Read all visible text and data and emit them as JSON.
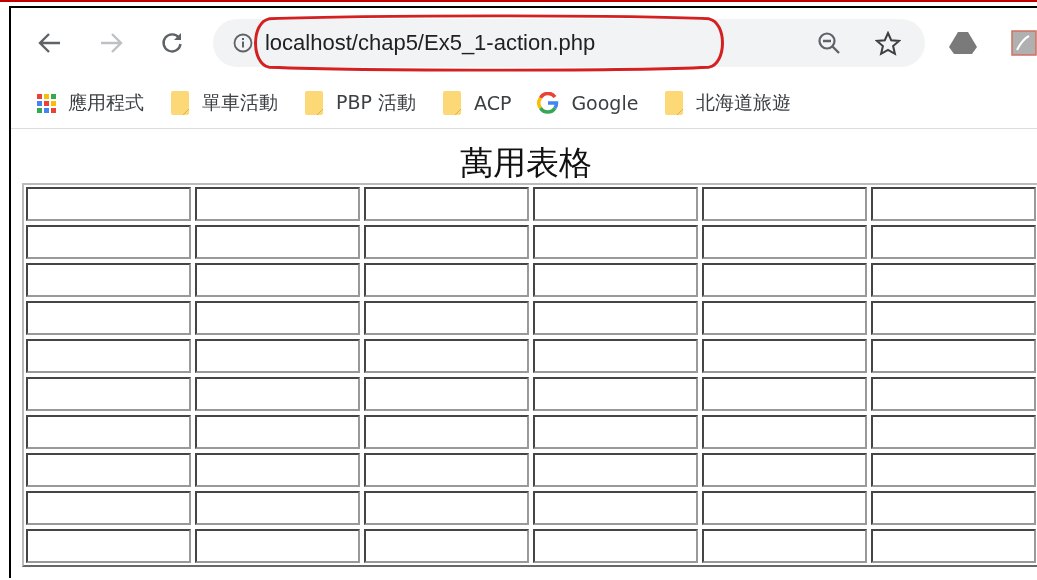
{
  "browser": {
    "url": "localhost/chap5/Ex5_1-action.php"
  },
  "bookmarks": [
    {
      "kind": "apps",
      "label": "應用程式"
    },
    {
      "kind": "folder",
      "label": "單車活動"
    },
    {
      "kind": "folder",
      "label": "PBP 活動"
    },
    {
      "kind": "folder",
      "label": "ACP"
    },
    {
      "kind": "google",
      "label": "Google"
    },
    {
      "kind": "folder",
      "label": "北海道旅遊"
    }
  ],
  "page": {
    "heading": "萬用表格",
    "table": {
      "rows": [
        {
          "cells": [
            {
              "kind": "blank"
            },
            {
              "kind": "blank"
            },
            {
              "kind": "blank"
            },
            {
              "kind": "blank"
            },
            {
              "kind": "blank"
            },
            {
              "kind": "blank"
            }
          ]
        },
        {
          "cells": [
            {
              "kind": "blank"
            },
            {
              "kind": "blank"
            },
            {
              "kind": "blank"
            },
            {
              "kind": "blank"
            },
            {
              "kind": "blank"
            },
            {
              "kind": "blank"
            }
          ]
        },
        {
          "cells": [
            {
              "kind": "blank"
            },
            {
              "kind": "blank"
            },
            {
              "kind": "blank"
            },
            {
              "kind": "blank"
            },
            {
              "kind": "blank"
            },
            {
              "kind": "blank"
            }
          ]
        },
        {
          "cells": [
            {
              "kind": "blank"
            },
            {
              "kind": "blank"
            },
            {
              "kind": "blank"
            },
            {
              "kind": "blank"
            },
            {
              "kind": "blank"
            },
            {
              "kind": "blank"
            }
          ]
        },
        {
          "cells": [
            {
              "kind": "blank"
            },
            {
              "kind": "blank"
            },
            {
              "kind": "blank"
            },
            {
              "kind": "blank"
            },
            {
              "kind": "blank"
            },
            {
              "kind": "blank"
            }
          ]
        },
        {
          "cells": [
            {
              "kind": "blank"
            },
            {
              "kind": "blank"
            },
            {
              "kind": "blank"
            },
            {
              "kind": "blank"
            },
            {
              "kind": "blank"
            },
            {
              "kind": "blank"
            }
          ]
        },
        {
          "cells": [
            {
              "kind": "blank"
            },
            {
              "kind": "blank"
            },
            {
              "kind": "blank"
            },
            {
              "kind": "blank"
            },
            {
              "kind": "blank"
            },
            {
              "kind": "blank"
            }
          ]
        },
        {
          "cells": [
            {
              "kind": "blank"
            },
            {
              "kind": "blank"
            },
            {
              "kind": "blank"
            },
            {
              "kind": "blank"
            },
            {
              "kind": "blank"
            },
            {
              "kind": "blank"
            }
          ]
        },
        {
          "cells": [
            {
              "kind": "blank"
            },
            {
              "kind": "blank"
            },
            {
              "kind": "blank"
            },
            {
              "kind": "blank"
            },
            {
              "kind": "blank"
            },
            {
              "kind": "blank"
            }
          ]
        },
        {
          "cells": [
            {
              "kind": "blank"
            },
            {
              "kind": "blank"
            },
            {
              "kind": "blank"
            },
            {
              "kind": "blank"
            },
            {
              "kind": "blank"
            },
            {
              "kind": "blank"
            }
          ]
        }
      ]
    }
  }
}
